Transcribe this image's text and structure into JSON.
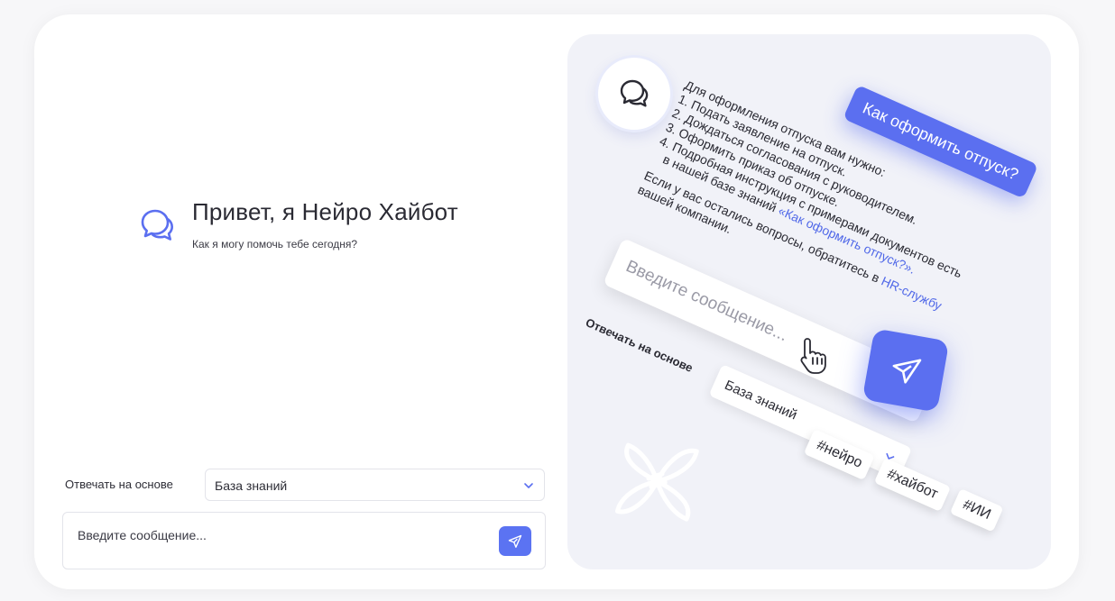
{
  "hero": {
    "title": "Привет, я Нейро Хайбот",
    "subtitle": "Как я могу помочь тебе сегодня?"
  },
  "form": {
    "answer_label": "Отвечать на основе",
    "source_value": "База знаний",
    "message_placeholder": "Введите сообщение..."
  },
  "illustration": {
    "user_question": "Как оформить отпуск?",
    "bot_reply": {
      "intro": "Для оформления отпуска вам нужно:",
      "steps": [
        "1. Подать заявление на отпуск.",
        "2. Дождаться согласования с руководителем.",
        "3. Оформить приказ об отпуске.",
        "4. Подробная инструкция с примерами документов есть"
      ],
      "kb_line_prefix": "в нашей базе знаний ",
      "kb_link": "«Как оформить отпуск?».",
      "hr_line_prefix": "Если у вас остались вопросы, обратитесь в ",
      "hr_link": "HR-службу",
      "hr_line_suffix": "вашей компании."
    },
    "input_placeholder": "Введите сообщение...",
    "answer_label": "Отвечать на основе",
    "source_value": "База знаний",
    "tags": [
      "#нейро",
      "#хайбот",
      "#ИИ"
    ]
  },
  "colors": {
    "accent": "#5b6ff0",
    "link": "#5068e8",
    "panel_bg": "#f1f2f8"
  },
  "icons": {
    "logo": "chat-bubbles-icon",
    "send": "paper-plane-icon",
    "dropdown": "chevron-down-icon",
    "cursor": "hand-pointer-icon",
    "decor": "flower-logo-icon"
  }
}
